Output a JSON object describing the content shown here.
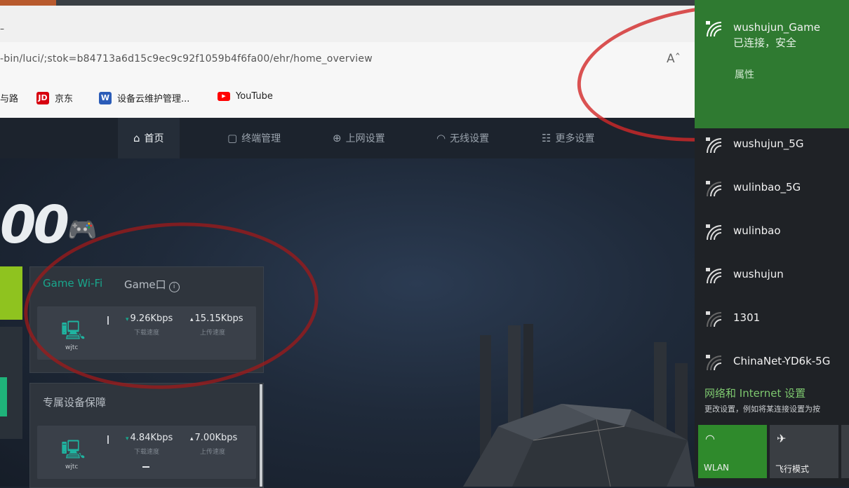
{
  "browser": {
    "tab_dash": "–",
    "address": "-bin/luci/;stok=b84713a6d15c9ec9c92f1059b4f6fa00/ehr/home_overview",
    "reader_icon": "Aˆ",
    "bookmarks": [
      {
        "icon_text": "",
        "label": "与路"
      },
      {
        "icon_text": "JD",
        "label": "京东"
      },
      {
        "icon_text": "W",
        "label": "设备云维护管理..."
      },
      {
        "icon_text": "▶",
        "label": "YouTube"
      }
    ]
  },
  "router": {
    "nav": [
      {
        "icon": "⌂",
        "label": "首页"
      },
      {
        "icon": "▢",
        "label": "终端管理"
      },
      {
        "icon": "⊕",
        "label": "上网设置"
      },
      {
        "icon": "◠",
        "label": "无线设置"
      },
      {
        "icon": "☷",
        "label": "更多设置"
      }
    ],
    "brand_text": "00",
    "card1": {
      "tab_active": "Game Wi-Fi",
      "tab_inactive": "Game口",
      "info": "i",
      "device_label": "wjtc",
      "down_speed": "9.26Kbps",
      "down_label": "下载速度",
      "up_speed": "15.15Kbps",
      "up_label": "上传速度"
    },
    "card2": {
      "title": "专属设备保障",
      "device_label": "wjtc",
      "down_speed": "4.84Kbps",
      "down_label": "下载速度",
      "up_speed": "7.00Kbps",
      "up_label": "上传速度"
    }
  },
  "wifi_flyout": {
    "connected": {
      "ssid": "wushujun_Game",
      "status": "已连接，安全",
      "properties": "属性"
    },
    "networks": [
      "wushujun_5G",
      "wulinbao_5G",
      "wulinbao",
      "wushujun",
      "1301",
      "ChinaNet-YD6k-5G"
    ],
    "settings_title": "网络和 Internet 设置",
    "settings_desc": "更改设置，例如将某连接设置为按",
    "tiles": [
      {
        "icon": "wifi-icon",
        "label": "WLAN"
      },
      {
        "icon": "airplane-icon",
        "label": "飞行模式"
      }
    ]
  },
  "colors": {
    "accent_teal": "#19a68c",
    "connected_green": "#2f7a31",
    "annotation_red": "#cd2323"
  }
}
